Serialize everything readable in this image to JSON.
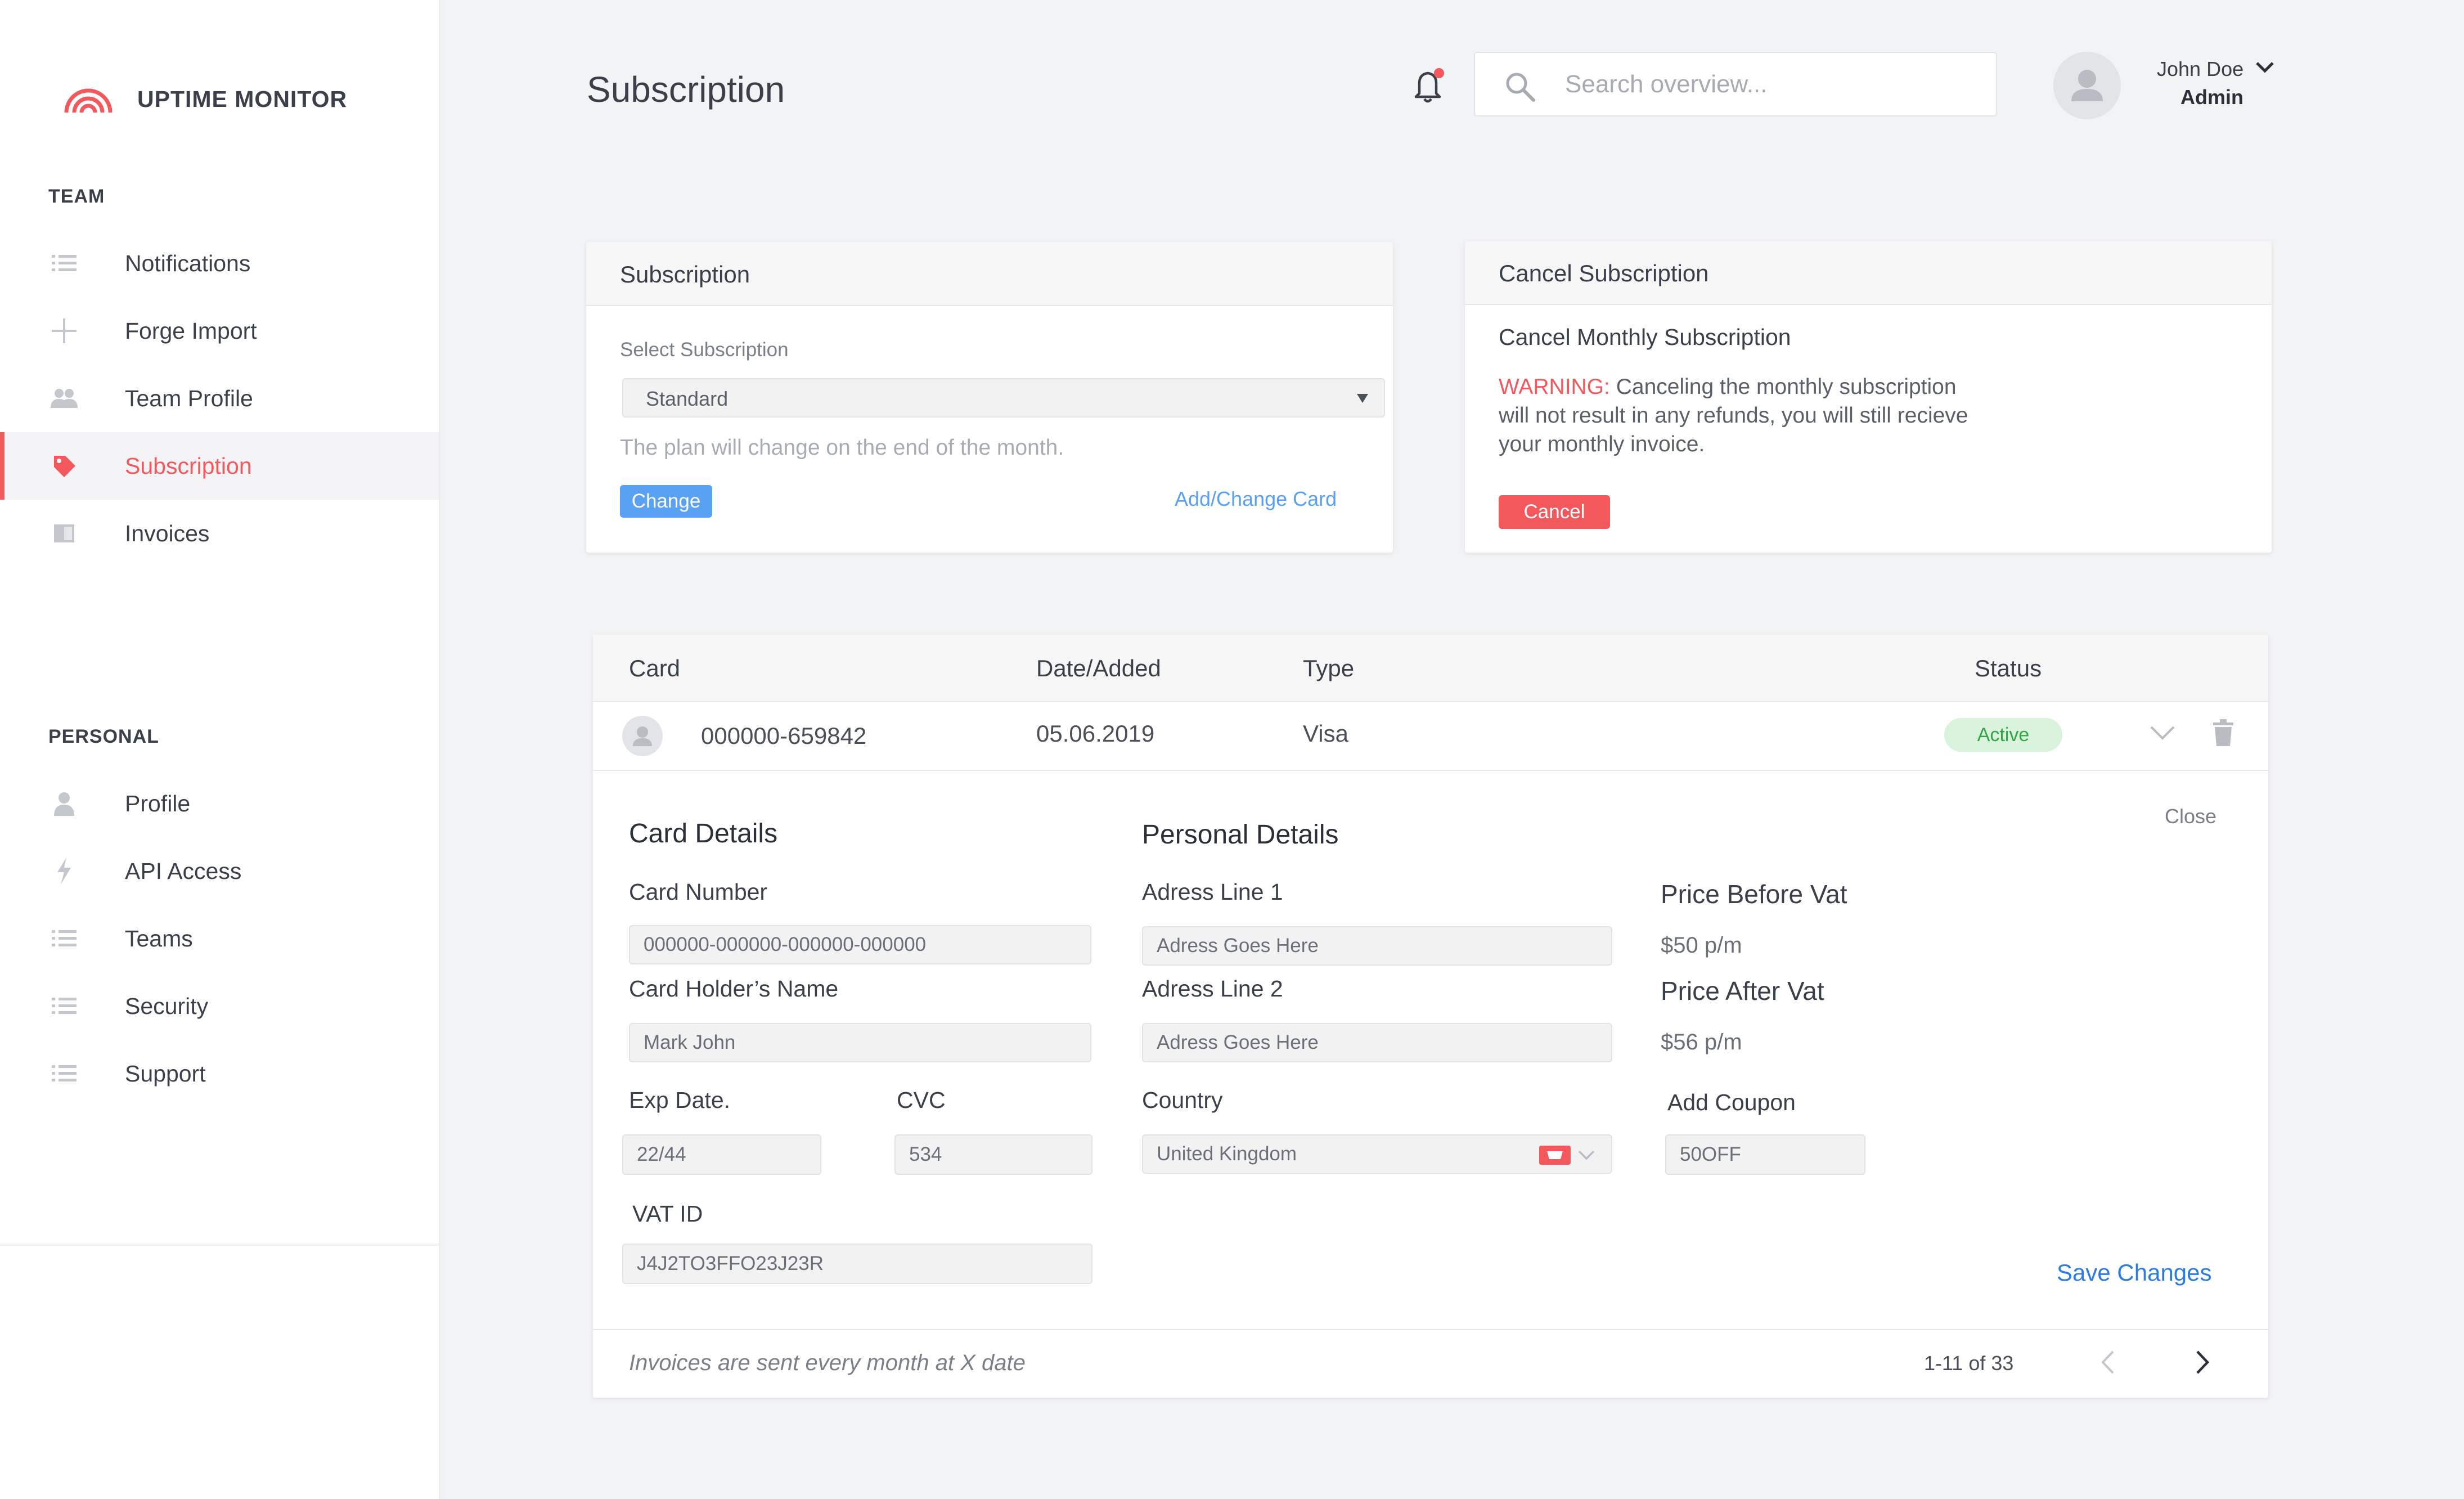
{
  "brand": {
    "name": "UPTIME MONITOR"
  },
  "sidebar": {
    "team_label": "TEAM",
    "team_items": [
      {
        "label": "Notifications",
        "icon": "list-icon"
      },
      {
        "label": "Forge Import",
        "icon": "plus-icon"
      },
      {
        "label": "Team Profile",
        "icon": "users-icon"
      },
      {
        "label": "Subscription",
        "icon": "tag-icon",
        "active": true
      },
      {
        "label": "Invoices",
        "icon": "book-icon"
      }
    ],
    "personal_label": "PERSONAL",
    "personal_items": [
      {
        "label": "Profile",
        "icon": "user-icon"
      },
      {
        "label": "API Access",
        "icon": "bolt-icon"
      },
      {
        "label": "Teams",
        "icon": "list-icon"
      },
      {
        "label": "Security",
        "icon": "list-icon"
      },
      {
        "label": "Support",
        "icon": "list-icon"
      }
    ]
  },
  "header": {
    "title": "Subscription",
    "search_placeholder": "Search overview...",
    "user_name": "John Doe",
    "user_role": "Admin"
  },
  "subscription_card": {
    "title": "Subscription",
    "select_label": "Select Subscription",
    "selected": "Standard",
    "hint": "The plan will change on the end of the month.",
    "change_button": "Change",
    "add_card_link": "Add/Change Card"
  },
  "cancel_card": {
    "title": "Cancel Subscription",
    "subtitle": "Cancel Monthly Subscription",
    "warning_prefix": "WARNING:",
    "warning_line1": " Canceling the monthly subscription",
    "warning_line2": "will not result in any refunds, you will still recieve",
    "warning_line3": "your monthly invoice.",
    "cancel_button": "Cancel"
  },
  "table": {
    "headers": {
      "card": "Card",
      "date": "Date/Added",
      "type": "Type",
      "status": "Status"
    },
    "row": {
      "card": "000000-659842",
      "date": "05.06.2019",
      "type": "Visa",
      "status": "Active"
    }
  },
  "details": {
    "close": "Close",
    "card_details_title": "Card Details",
    "card_number_label": "Card Number",
    "card_number_placeholder": "000000-000000-000000-000000",
    "holder_label": "Card Holder’s Name",
    "holder_value": "Mark John",
    "exp_label": "Exp Date.",
    "exp_value": "22/44",
    "cvc_label": "CVC",
    "cvc_value": "534",
    "vat_label": "VAT ID",
    "vat_value": "J4J2TO3FFO23J23R",
    "personal_title": "Personal Details",
    "address1_label": "Adress Line 1",
    "address1_placeholder": "Adress Goes Here",
    "address2_label": "Adress Line 2",
    "address2_placeholder": "Adress Goes Here",
    "country_label": "Country",
    "country_value": "United Kingdom",
    "price_before_label": "Price Before Vat",
    "price_before_value": "$50 p/m",
    "price_after_label": "Price After Vat",
    "price_after_value": "$56 p/m",
    "coupon_label": "Add Coupon",
    "coupon_value": "50OFF",
    "save_button": "Save Changes"
  },
  "footer": {
    "note": "Invoices are sent every month at X date",
    "pagination": "1-11 of 33"
  },
  "colors": {
    "accent": "#f2585c",
    "blue": "#59a1f2",
    "active_bg": "#d9f3dc",
    "active_text": "#34a544"
  }
}
